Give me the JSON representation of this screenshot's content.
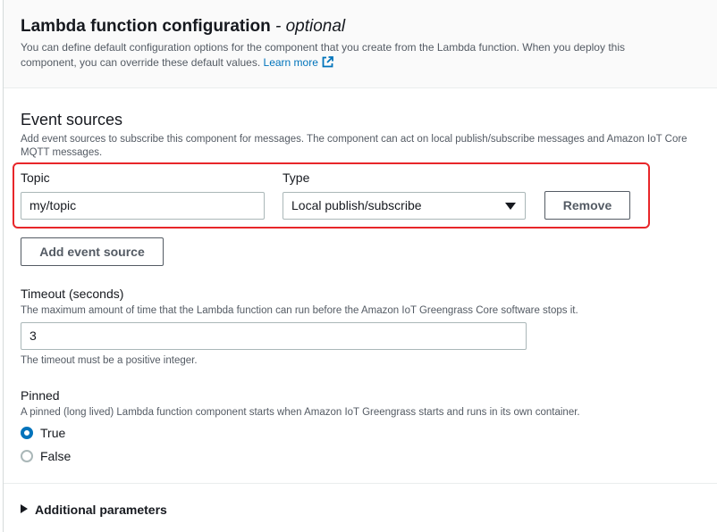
{
  "header": {
    "title": "Lambda function configuration",
    "title_suffix": "- optional",
    "description": "You can define default configuration options for the component that you create from the Lambda function. When you deploy this component, you can override these default values.",
    "learn_more": "Learn more",
    "link_icon": "external-link-icon"
  },
  "event_sources": {
    "title": "Event sources",
    "description": "Add event sources to subscribe this component for messages. The component can act on local publish/subscribe messages and Amazon IoT Core MQTT messages.",
    "topic_label": "Topic",
    "topic_value": "my/topic",
    "type_label": "Type",
    "type_value": "Local publish/subscribe",
    "remove_label": "Remove",
    "add_label": "Add event source"
  },
  "timeout": {
    "label": "Timeout (seconds)",
    "description": "The maximum amount of time that the Lambda function can run before the Amazon IoT Greengrass Core software stops it.",
    "value": "3",
    "hint": "The timeout must be a positive integer."
  },
  "pinned": {
    "label": "Pinned",
    "description": "A pinned (long lived) Lambda function component starts when Amazon IoT Greengrass starts and runs in its own container.",
    "options": [
      {
        "label": "True",
        "selected": true
      },
      {
        "label": "False",
        "selected": false
      }
    ]
  },
  "additional": {
    "label": "Additional parameters"
  },
  "colors": {
    "link": "#0073bb",
    "highlight": "#e8262a",
    "text": "#16191f",
    "muted": "#545b64"
  }
}
